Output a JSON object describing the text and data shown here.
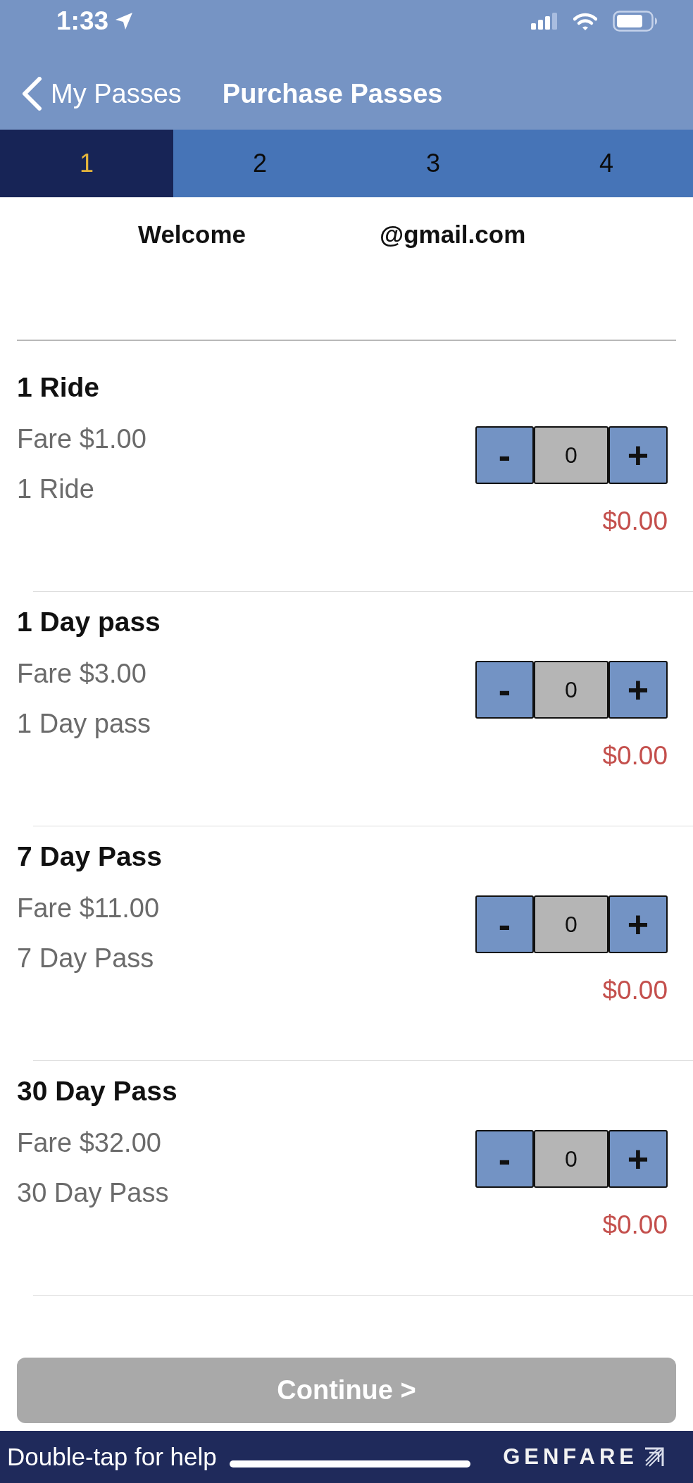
{
  "status_bar": {
    "time": "1:33"
  },
  "nav_bar": {
    "back_label": "My Passes",
    "title": "Purchase Passes"
  },
  "steps": [
    {
      "label": "1",
      "selected": true
    },
    {
      "label": "2",
      "selected": false
    },
    {
      "label": "3",
      "selected": false
    },
    {
      "label": "4",
      "selected": false
    }
  ],
  "welcome": {
    "greeting": "Welcome",
    "email": "@gmail.com"
  },
  "passes": [
    {
      "name": "1 Ride",
      "fare": "Fare $1.00",
      "description": "1 Ride",
      "decrement": "-",
      "quantity": "0",
      "increment": "+",
      "total": "$0.00"
    },
    {
      "name": "1 Day pass",
      "fare": "Fare $3.00",
      "description": "1 Day pass",
      "decrement": "-",
      "quantity": "0",
      "increment": "+",
      "total": "$0.00"
    },
    {
      "name": "7 Day Pass",
      "fare": "Fare $11.00",
      "description": "7 Day Pass",
      "decrement": "-",
      "quantity": "0",
      "increment": "+",
      "total": "$0.00"
    },
    {
      "name": "30 Day Pass",
      "fare": "Fare $32.00",
      "description": "30 Day Pass",
      "decrement": "-",
      "quantity": "0",
      "increment": "+",
      "total": "$0.00"
    }
  ],
  "continue_button": {
    "label": "Continue >",
    "disabled": true
  },
  "footer": {
    "help_text": "Double-tap for help",
    "brand": "GENFARE"
  }
}
